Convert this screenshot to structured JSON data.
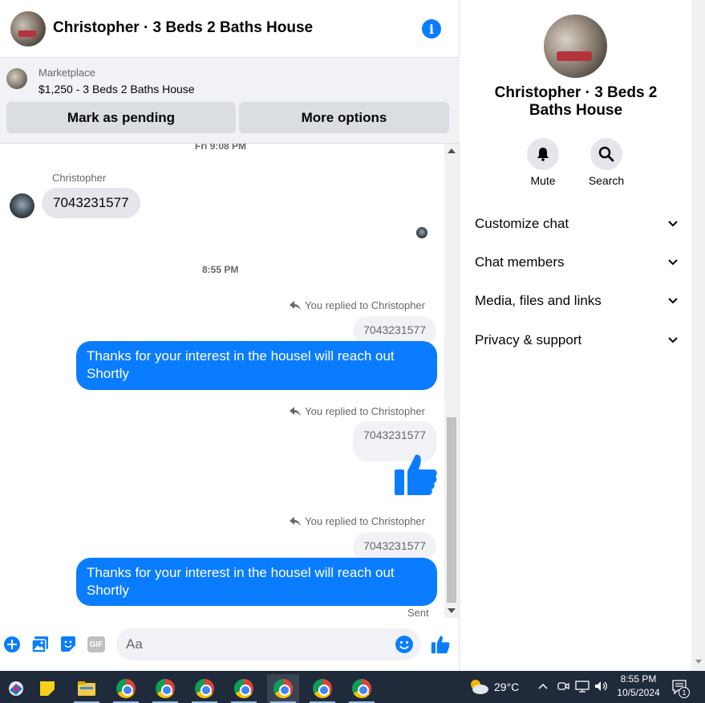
{
  "chat": {
    "title": "Christopher · 3 Beds 2 Baths House",
    "info_icon": "info-icon",
    "marketplace": {
      "label": "Marketplace",
      "item": "$1,250 - 3 Beds 2 Baths House",
      "mark_pending": "Mark as pending",
      "more_options": "More options"
    },
    "messages": {
      "timestamp_top": "Fri 9:08 PM",
      "sender": "Christopher",
      "incoming_text": "7043231577",
      "timestamp_mid": "8:55 PM",
      "replied_1": "You replied to Christopher",
      "quote_1": "7043231577",
      "outgoing_1": "Thanks for your interest in the housel will reach out Shortly",
      "replied_2": "You replied to Christopher",
      "quote_2": "7043231577",
      "like_icon": "thumbs-up-icon",
      "replied_3": "You replied to Christopher",
      "quote_3": "7043231577",
      "outgoing_2": "Thanks for your interest in the housel will reach out Shortly",
      "status": "Sent"
    },
    "composer": {
      "placeholder": "Aa",
      "icons": [
        "plus-icon",
        "photo-icon",
        "sticker-icon",
        "gif-icon",
        "emoji-icon",
        "thumbs-up-icon"
      ],
      "gif_label": "GIF"
    }
  },
  "info_panel": {
    "name": "Christopher · 3 Beds 2 Baths House",
    "mute_label": "Mute",
    "search_label": "Search",
    "sections": [
      {
        "label": "Customize chat"
      },
      {
        "label": "Chat members"
      },
      {
        "label": "Media, files and links"
      },
      {
        "label": "Privacy & support"
      }
    ]
  },
  "taskbar": {
    "weather": "29°C",
    "time": "8:55 PM",
    "date": "10/5/2024",
    "notification_count": "1"
  },
  "colors": {
    "accent": "#0a7cff",
    "bubble_in": "#e4e6eb",
    "taskbar": "#1f2a3a"
  }
}
